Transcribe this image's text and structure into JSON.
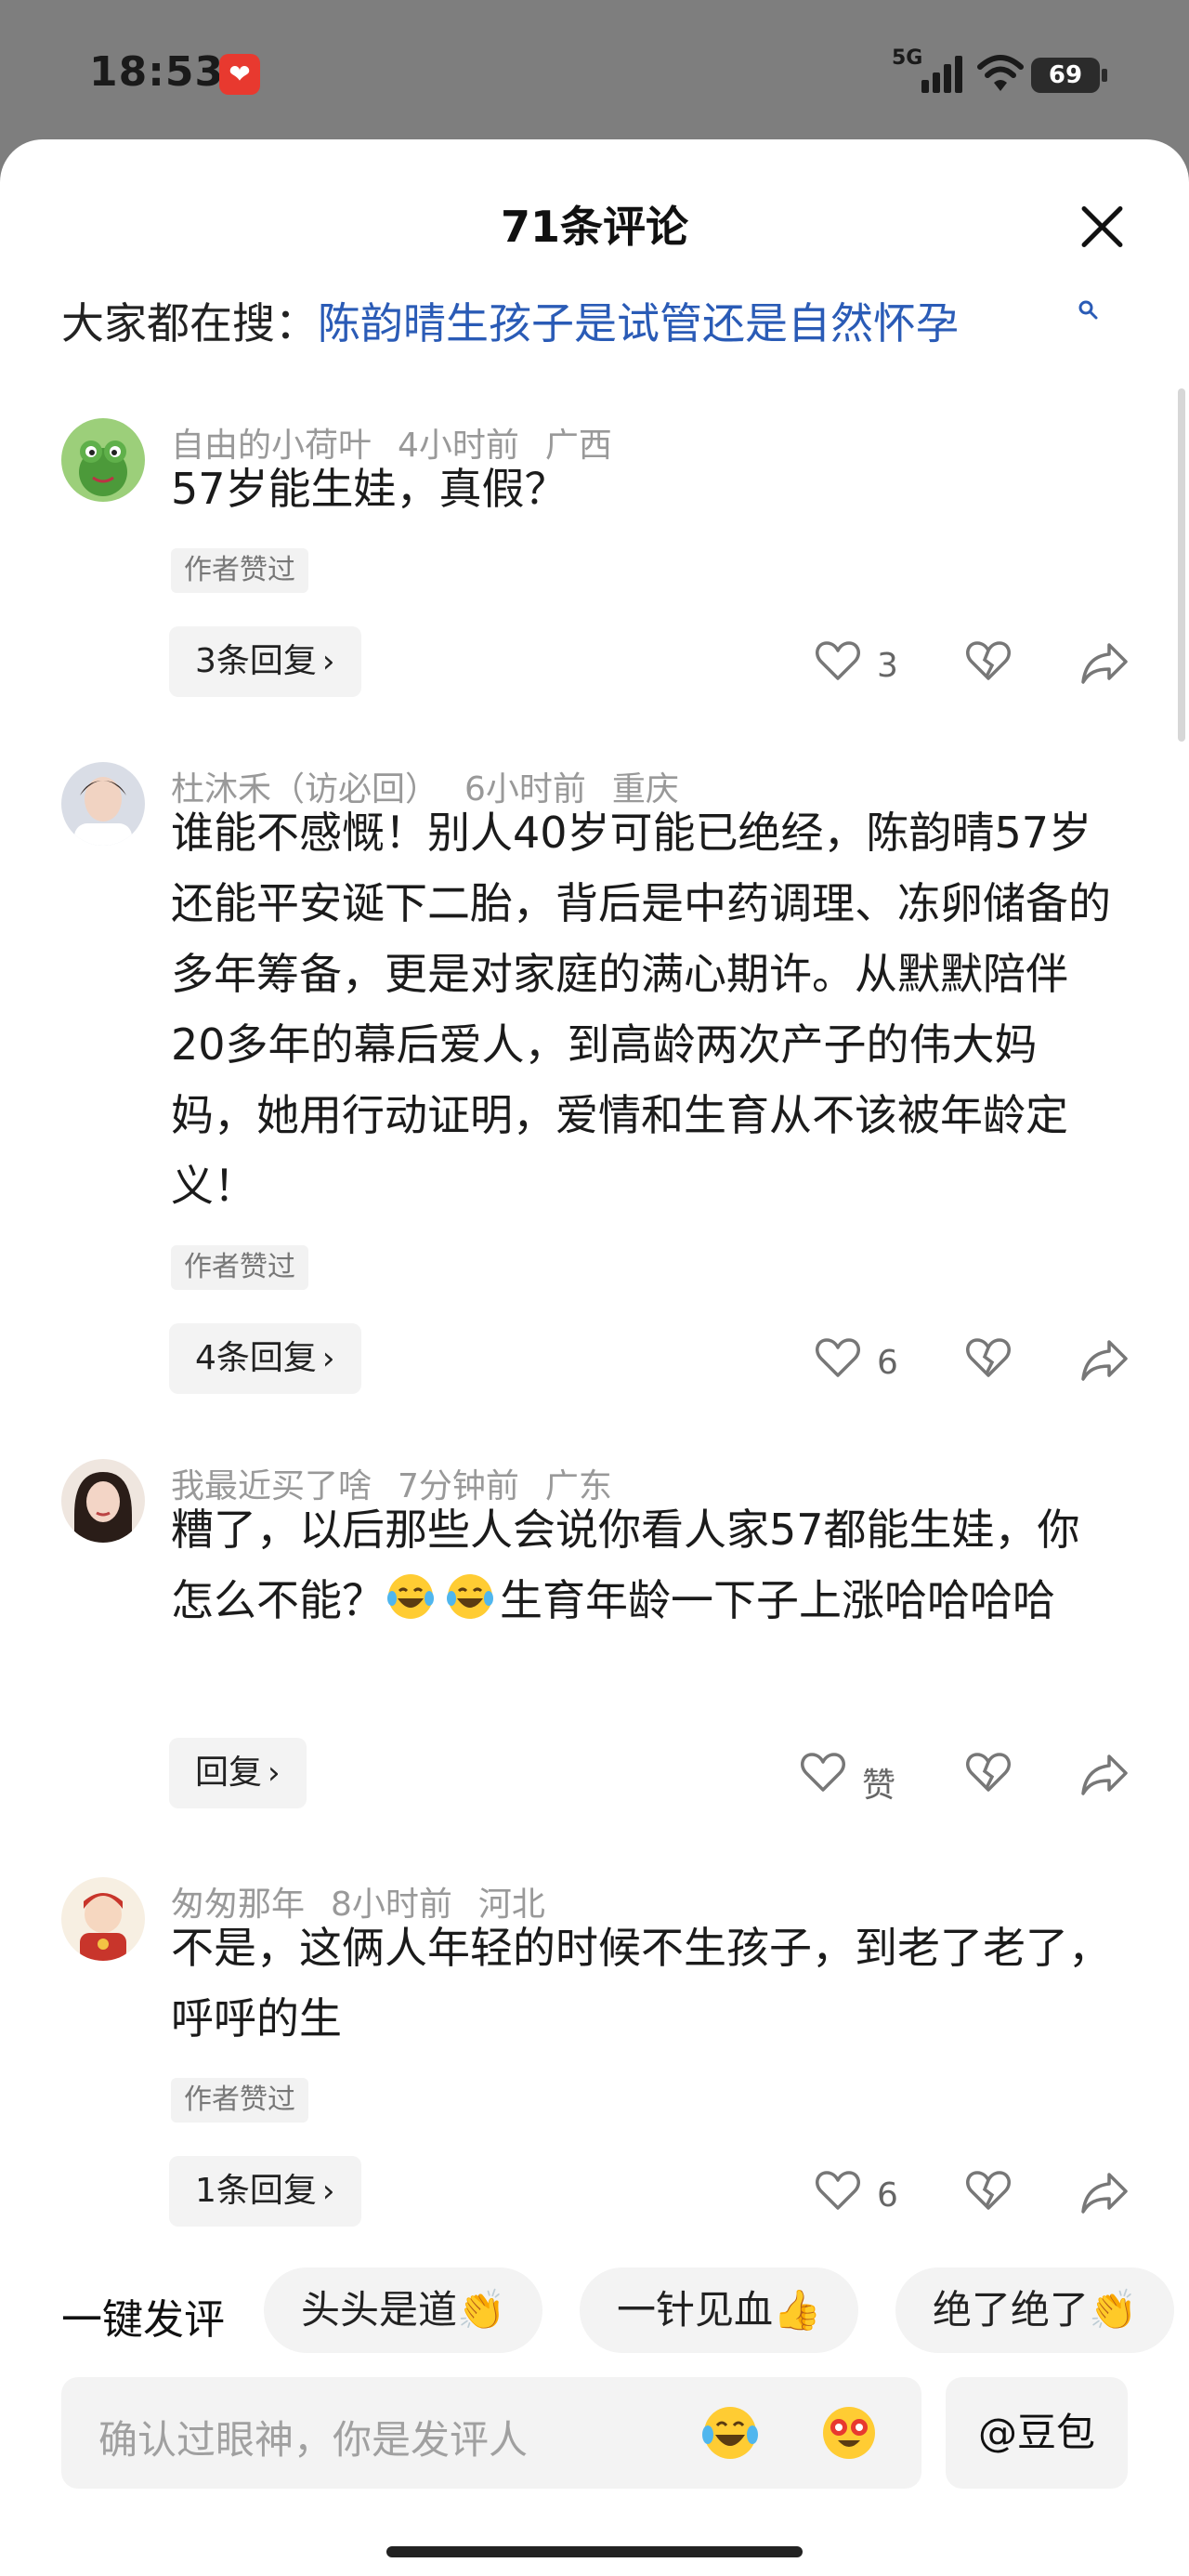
{
  "status_bar": {
    "time": "18:53",
    "network": "5G",
    "battery": "69"
  },
  "sheet": {
    "title": "71条评论",
    "hot_search_label": "大家都在搜：",
    "hot_search_query": "陈韵晴生孩子是试管还是自然怀孕"
  },
  "comments": [
    {
      "user": "自由的小荷叶",
      "time": "4小时前",
      "location": "广西",
      "text": "57岁能生娃，真假？",
      "author_liked": "作者赞过",
      "reply_label": "3条回复",
      "likes": "3"
    },
    {
      "user": "杜沐禾（访必回）",
      "time": "6小时前",
      "location": "重庆",
      "text": "谁能不感慨！别人40岁可能已绝经，陈韵晴57岁还能平安诞下二胎，背后是中药调理、冻卵储备的多年筹备，更是对家庭的满心期许。从默默陪伴20多年的幕后爱人，到高龄两次产子的伟大妈妈，她用行动证明，爱情和生育从不该被年龄定义！",
      "author_liked": "作者赞过",
      "reply_label": "4条回复",
      "likes": "6"
    },
    {
      "user": "我最近买了啥",
      "time": "7分钟前",
      "location": "广东",
      "text_part1": "糟了，以后那些人会说你看人家57都能生娃，你怎么不能？",
      "text_part2": "生育年龄一下子上涨哈哈哈哈",
      "reply_label": "回复",
      "likes": "赞"
    },
    {
      "user": "匆匆那年",
      "time": "8小时前",
      "location": "河北",
      "text": "不是，这俩人年轻的时候不生孩子，到老了老了，呼呼的生",
      "author_liked": "作者赞过",
      "reply_label": "1条回复",
      "likes": "6"
    }
  ],
  "quick_comment": {
    "label": "一键发评",
    "chips": [
      "头头是道",
      "一针见血",
      "绝了绝了"
    ]
  },
  "input": {
    "placeholder": "确认过眼神，你是发评人",
    "doubao_label": "@豆包"
  }
}
